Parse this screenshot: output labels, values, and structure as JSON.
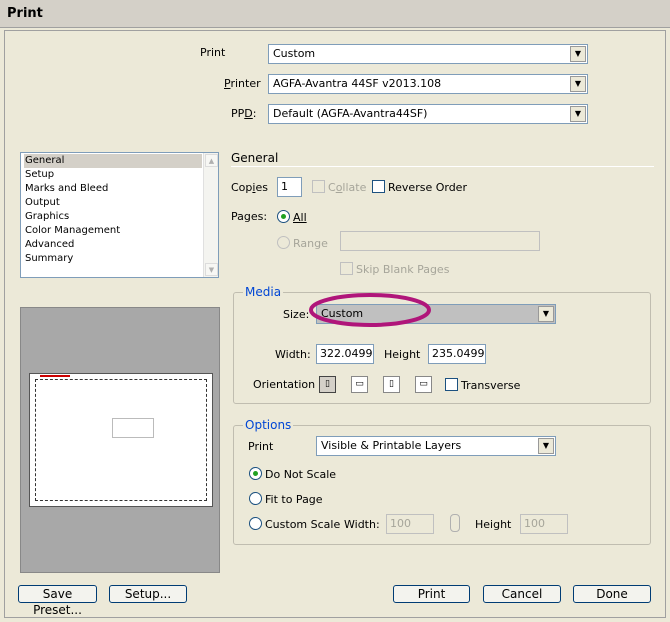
{
  "window": {
    "title": "Print"
  },
  "top": {
    "preset_label": "Print",
    "preset_value": "Custom",
    "printer_label_pre": "",
    "printer_label_u": "P",
    "printer_label_post": "rinter",
    "printer_value": "AGFA-Avantra 44SF v2013.108",
    "ppd_label_pre": "PP",
    "ppd_label_u": "D",
    "ppd_label_post": ":",
    "ppd_value": "Default (AGFA-Avantra44SF)"
  },
  "sidebar": {
    "items": [
      {
        "label": "General"
      },
      {
        "label": "Setup"
      },
      {
        "label": "Marks and Bleed"
      },
      {
        "label": "Output"
      },
      {
        "label": "Graphics"
      },
      {
        "label": "Color Management"
      },
      {
        "label": "Advanced"
      },
      {
        "label": "Summary"
      }
    ]
  },
  "general": {
    "heading": "General",
    "copies_label_pre": "Cop",
    "copies_label_u": "i",
    "copies_label_post": "es",
    "copies_value": "1",
    "collate_pre": "C",
    "collate_u": "o",
    "collate_post": "llate",
    "reverse_label": "Reverse Order",
    "pages_label": "Pages:",
    "all_label": "All",
    "range_label": "Range",
    "skip_blank_label": "Skip Blank Pages"
  },
  "media": {
    "title": "Media",
    "size_label": "Size:",
    "size_value": "Custom",
    "width_label": "Width:",
    "width_value": "322.0499",
    "height_label": "Height",
    "height_value": "235.0499",
    "orientation_label": "Orientation",
    "transverse_label": "Transverse"
  },
  "options": {
    "title": "Options",
    "print_label": "Print",
    "print_value": "Visible & Printable Layers",
    "do_not_scale_label": "Do Not Scale",
    "fit_to_page_label": "Fit to Page",
    "custom_scale_label": "Custom Scale",
    "width_label": "Width:",
    "width_value": "100",
    "height_label": "Height",
    "height_value": "100"
  },
  "buttons": {
    "save_preset": "Save Preset...",
    "setup": "Setup...",
    "print": "Print",
    "cancel": "Cancel",
    "done": "Done"
  },
  "colors": {
    "group_title": "#0046d5",
    "highlight_annotation": "#b0157a",
    "radio_dot": "#21a121"
  },
  "icons": [
    "dropdown-arrow-icon",
    "link-icon",
    "orientation-portrait-icon",
    "orientation-landscape-icon",
    "orientation-portrait-flipped-icon",
    "orientation-landscape-flipped-icon"
  ]
}
